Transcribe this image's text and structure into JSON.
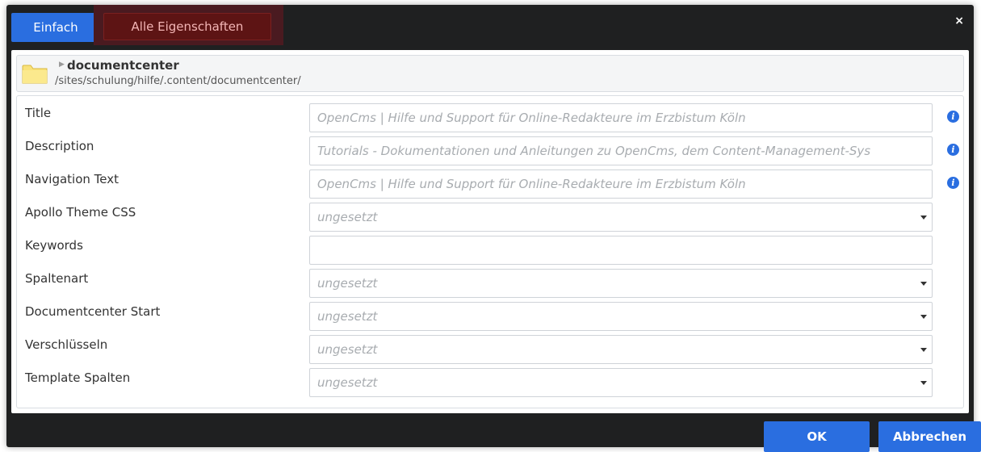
{
  "tabs": {
    "simple": "Einfach",
    "all": "Alle Eigenschaften"
  },
  "close_label": "×",
  "resource": {
    "name": "documentcenter",
    "path": "/sites/schulung/hilfe/.content/documentcenter/"
  },
  "fields": [
    {
      "label": "Title",
      "value": "OpenCms | Hilfe und Support für Online-Redakteure im Erzbistum Köln",
      "type": "text",
      "info": true
    },
    {
      "label": "Description",
      "value": "Tutorials - Dokumentationen und Anleitungen zu OpenCms, dem Content-Management-Sys",
      "type": "text",
      "info": true
    },
    {
      "label": "Navigation Text",
      "value": "OpenCms | Hilfe und Support für Online-Redakteure im Erzbistum Köln",
      "type": "text",
      "info": true
    },
    {
      "label": "Apollo Theme CSS",
      "value": "ungesetzt",
      "type": "select",
      "info": false
    },
    {
      "label": "Keywords",
      "value": "",
      "type": "text",
      "info": false
    },
    {
      "label": "Spaltenart",
      "value": "ungesetzt",
      "type": "select",
      "info": false
    },
    {
      "label": "Documentcenter Start",
      "value": "ungesetzt",
      "type": "select",
      "info": false
    },
    {
      "label": "Verschlüsseln",
      "value": "ungesetzt",
      "type": "select",
      "info": false
    },
    {
      "label": "Template Spalten",
      "value": "ungesetzt",
      "type": "select",
      "info": false
    }
  ],
  "info_glyph": "i",
  "buttons": {
    "ok": "OK",
    "cancel": "Abbrechen"
  },
  "colors": {
    "accent": "#2a6ee0",
    "selected_tab": "#5d1414",
    "dialog": "#1f2021"
  }
}
